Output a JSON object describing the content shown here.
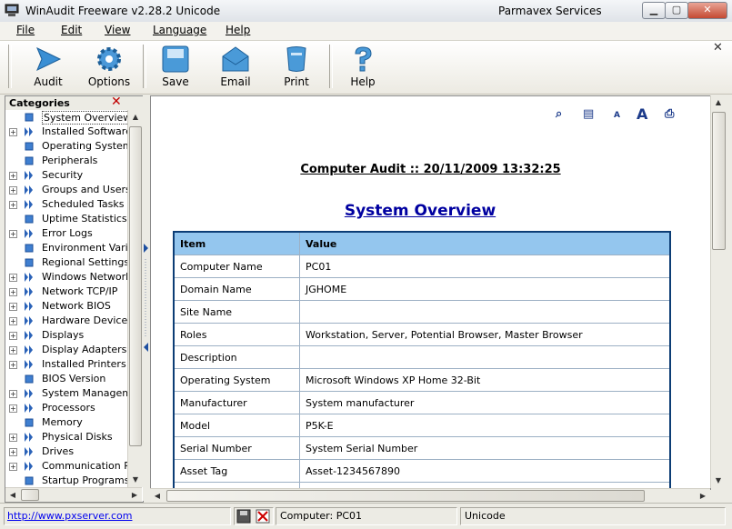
{
  "window": {
    "title": "WinAudit Freeware v2.28.2 Unicode",
    "company": "Parmavex Services",
    "controls": [
      "minimize",
      "maximize",
      "close"
    ]
  },
  "menu": [
    "File",
    "Edit",
    "View",
    "Language",
    "Help"
  ],
  "toolbar": {
    "buttons": [
      {
        "label": "Audit",
        "icon": "play-arrow-icon"
      },
      {
        "label": "Options",
        "icon": "gear-icon"
      },
      {
        "label": "Save",
        "icon": "disk-icon"
      },
      {
        "label": "Email",
        "icon": "envelope-icon"
      },
      {
        "label": "Print",
        "icon": "printer-icon"
      },
      {
        "label": "Help",
        "icon": "question-icon"
      }
    ]
  },
  "sidebar": {
    "title": "Categories",
    "items": [
      {
        "label": "System Overview",
        "expandable": false,
        "icon": "square",
        "selected": true
      },
      {
        "label": "Installed Software",
        "expandable": true,
        "icon": "arrow"
      },
      {
        "label": "Operating System",
        "expandable": false,
        "icon": "square"
      },
      {
        "label": "Peripherals",
        "expandable": false,
        "icon": "square"
      },
      {
        "label": "Security",
        "expandable": true,
        "icon": "arrow"
      },
      {
        "label": "Groups and Users",
        "expandable": true,
        "icon": "arrow"
      },
      {
        "label": "Scheduled Tasks",
        "expandable": true,
        "icon": "arrow"
      },
      {
        "label": "Uptime Statistics",
        "expandable": false,
        "icon": "square"
      },
      {
        "label": "Error Logs",
        "expandable": true,
        "icon": "arrow"
      },
      {
        "label": "Environment Variab",
        "expandable": false,
        "icon": "square"
      },
      {
        "label": "Regional Settings",
        "expandable": false,
        "icon": "square"
      },
      {
        "label": "Windows Network",
        "expandable": true,
        "icon": "arrow"
      },
      {
        "label": "Network TCP/IP",
        "expandable": true,
        "icon": "arrow"
      },
      {
        "label": "Network BIOS",
        "expandable": true,
        "icon": "arrow"
      },
      {
        "label": "Hardware Devices",
        "expandable": true,
        "icon": "arrow"
      },
      {
        "label": "Displays",
        "expandable": true,
        "icon": "arrow"
      },
      {
        "label": "Display Adapters",
        "expandable": true,
        "icon": "arrow"
      },
      {
        "label": "Installed Printers",
        "expandable": true,
        "icon": "arrow"
      },
      {
        "label": "BIOS Version",
        "expandable": false,
        "icon": "square"
      },
      {
        "label": "System Manageme",
        "expandable": true,
        "icon": "arrow"
      },
      {
        "label": "Processors",
        "expandable": true,
        "icon": "arrow"
      },
      {
        "label": "Memory",
        "expandable": false,
        "icon": "square"
      },
      {
        "label": "Physical Disks",
        "expandable": true,
        "icon": "arrow"
      },
      {
        "label": "Drives",
        "expandable": true,
        "icon": "arrow"
      },
      {
        "label": "Communication Por",
        "expandable": true,
        "icon": "arrow"
      },
      {
        "label": "Startup Programs",
        "expandable": false,
        "icon": "square"
      }
    ]
  },
  "report": {
    "audit_heading": "Computer Audit :: 20/11/2009 13:32:25",
    "section_heading": "System Overview",
    "columns": [
      "Item",
      "Value"
    ],
    "rows": [
      [
        "Computer Name",
        "PC01"
      ],
      [
        "Domain Name",
        "JGHOME"
      ],
      [
        "Site Name",
        ""
      ],
      [
        "Roles",
        "Workstation, Server, Potential Browser, Master Browser"
      ],
      [
        "Description",
        ""
      ],
      [
        "Operating System",
        "Microsoft Windows XP Home 32-Bit"
      ],
      [
        "Manufacturer",
        "System manufacturer"
      ],
      [
        "Model",
        "P5K-E"
      ],
      [
        "Serial Number",
        "System Serial Number"
      ],
      [
        "Asset Tag",
        "Asset-1234567890"
      ],
      [
        "",
        ""
      ]
    ]
  },
  "status": {
    "link": "http://www.pxserver.com",
    "computer": "Computer: PC01",
    "encoding": "Unicode"
  }
}
